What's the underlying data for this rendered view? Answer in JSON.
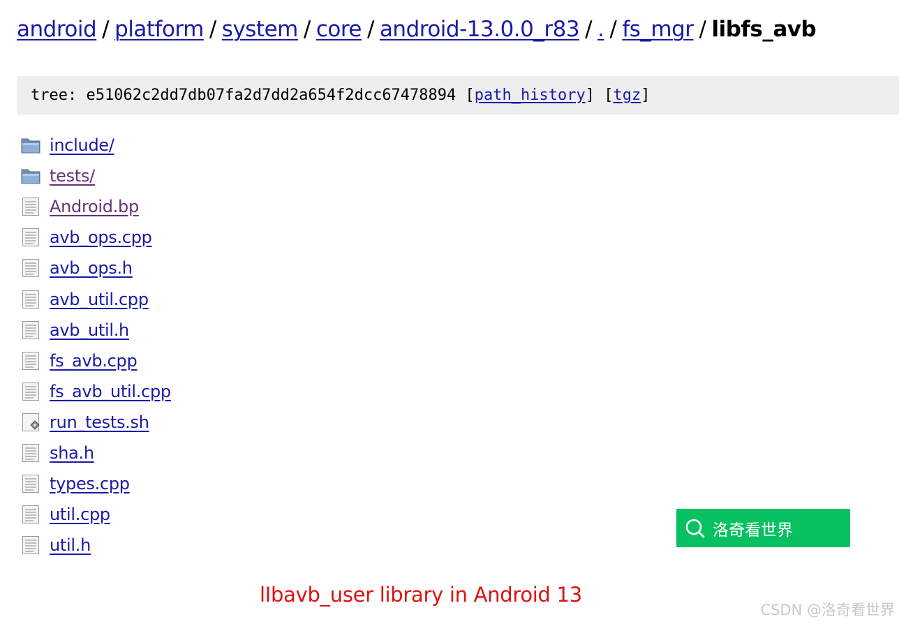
{
  "breadcrumb": {
    "links": [
      "android",
      "platform",
      "system",
      "core",
      "android-13.0.0_r83",
      ".",
      "fs_mgr"
    ],
    "separator": "/",
    "current": "libfs_avb"
  },
  "metabar": {
    "tree_prefix": "tree: e51062c2dd7db07fa2d7dd2a654f2dcc67478894 [",
    "path_history": "path_history",
    "mid": "] [",
    "tgz": "tgz",
    "suffix": "]"
  },
  "files": [
    {
      "name": "include/",
      "icon": "folder-icon",
      "visited": false
    },
    {
      "name": "tests/",
      "icon": "folder-icon",
      "visited": true
    },
    {
      "name": "Android.bp",
      "icon": "file-icon",
      "visited": true
    },
    {
      "name": "avb_ops.cpp",
      "icon": "file-icon",
      "visited": false
    },
    {
      "name": "avb_ops.h",
      "icon": "file-icon",
      "visited": false
    },
    {
      "name": "avb_util.cpp",
      "icon": "file-icon",
      "visited": false
    },
    {
      "name": "avb_util.h",
      "icon": "file-icon",
      "visited": false
    },
    {
      "name": "fs_avb.cpp",
      "icon": "file-icon",
      "visited": false
    },
    {
      "name": "fs_avb_util.cpp",
      "icon": "file-icon",
      "visited": false
    },
    {
      "name": "run_tests.sh",
      "icon": "script-icon",
      "visited": false
    },
    {
      "name": "sha.h",
      "icon": "file-icon",
      "visited": false
    },
    {
      "name": "types.cpp",
      "icon": "file-icon",
      "visited": false
    },
    {
      "name": "util.cpp",
      "icon": "file-icon",
      "visited": false
    },
    {
      "name": "util.h",
      "icon": "file-icon",
      "visited": false
    }
  ],
  "search_chip": {
    "label": "洛奇看世界",
    "icon": "search-icon",
    "color": "#07c160"
  },
  "caption": "lIbavb_user library in Android 13",
  "watermark": "CSDN @洛奇看世界",
  "colors": {
    "link": "#1a1aa6",
    "visited": "#68307a",
    "caption": "#e01010"
  }
}
